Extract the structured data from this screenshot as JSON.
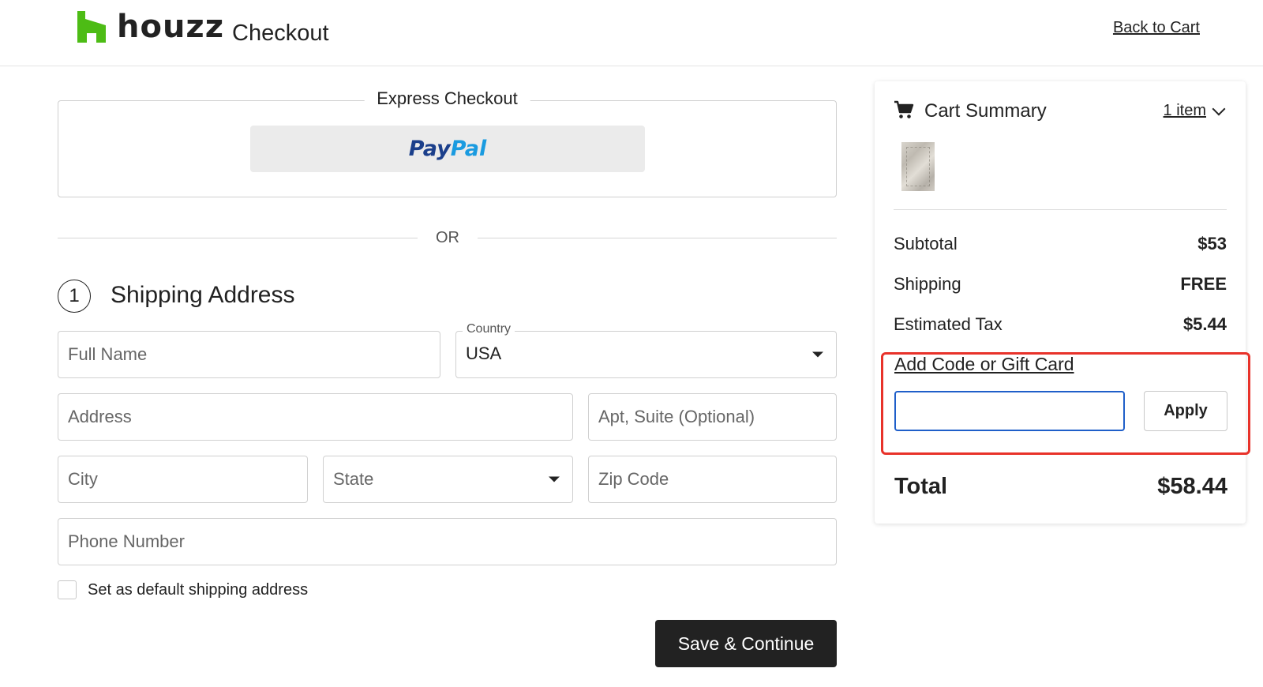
{
  "header": {
    "brand": "houzz",
    "page_title": "Checkout",
    "back_link": "Back to Cart",
    "brand_color": "#4dbc15"
  },
  "express": {
    "title": "Express Checkout",
    "paypal_part1": "Pay",
    "paypal_part2": "Pal",
    "or_text": "OR"
  },
  "shipping": {
    "step_number": "1",
    "title": "Shipping Address",
    "full_name_placeholder": "Full Name",
    "country_label": "Country",
    "country_value": "USA",
    "address_placeholder": "Address",
    "apt_placeholder": "Apt, Suite (Optional)",
    "city_placeholder": "City",
    "state_value": "State",
    "zip_placeholder": "Zip Code",
    "phone_placeholder": "Phone Number",
    "default_checkbox_label": "Set as default shipping address",
    "save_button": "Save & Continue"
  },
  "cart": {
    "title": "Cart Summary",
    "item_count": "1 item",
    "subtotal_label": "Subtotal",
    "subtotal_value": "$53",
    "shipping_label": "Shipping",
    "shipping_value": "FREE",
    "tax_label": "Estimated Tax",
    "tax_value": "$5.44",
    "promo_link": "Add Code or Gift Card",
    "promo_input_value": "",
    "apply_button": "Apply",
    "total_label": "Total",
    "total_value": "$58.44"
  },
  "colors": {
    "highlight_border": "#e8322a",
    "focus_border": "#1f5fc9",
    "primary_button": "#222222"
  }
}
